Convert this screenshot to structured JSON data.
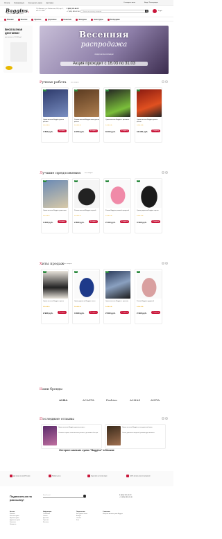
{
  "topbar": {
    "links": [
      "Оплата",
      "Информация",
      "Как сделать заказ",
      "Доставка"
    ],
    "track_label": "Отследить заказ",
    "account_label": "Вход / Регистрация"
  },
  "header": {
    "logo": "Baggins",
    "logo_tagline": "Сумки, рюкзаки и аксессуары",
    "address": "ТЦ «Москва», ул. Люблинская, 169, кор. 2, пав. 2С-136/1",
    "phone": "8 (800) 301-48-22",
    "phone_alt": "+7 (495) 989-47-40",
    "search_placeholder": "Поиск по каталогу товаров",
    "cart_total": "0 руб."
  },
  "nav": {
    "items": [
      "Рюкзаки",
      "Женские",
      "Мужские",
      "Дорожные",
      "Кошельки",
      "Чемоданы",
      "Аксессуары",
      "Распродажа"
    ]
  },
  "promo": {
    "title": "Бесплатная доставка!",
    "subtitle": "при заказе от 10 000 руб."
  },
  "banner": {
    "line1": "Весенняя",
    "line2": "распродажа",
    "line3": "Акция проходит с 16.03 по 31.03",
    "sub": "скидки на все коллекции"
  },
  "sections": {
    "handmade": {
      "title_first": "Р",
      "title_rest": "учная работа",
      "all": "все товары"
    },
    "best": {
      "title_first": "Л",
      "title_rest": "учшие предложения",
      "all": "все товары"
    },
    "hits": {
      "title_first": "Х",
      "title_rest": "иты продаж",
      "all": "все товары"
    },
    "brands": {
      "title_first": "Н",
      "title_rest": "аши бренды"
    },
    "reviews": {
      "title_first": "П",
      "title_rest": "оследние отзывы"
    }
  },
  "cards": [
    {
      "name": "Сумка женская Baggins ручная роспись",
      "stars": "★★★★★",
      "price": "7 890 руб.",
      "cart": "В корзину",
      "badge": "Хит"
    },
    {
      "name": "Рюкзак женский Baggins кожа ручная работа",
      "stars": "★★★★★",
      "price": "9 450 руб.",
      "cart": "В корзину",
      "badge": "Хит"
    },
    {
      "name": "Сумка женская Baggins с росписью",
      "stars": "★★★★★",
      "price": "8 200 руб.",
      "cart": "В корзину",
      "badge": "Хит"
    },
    {
      "name": "Сумка женская Baggins ручная работа",
      "stars": "★★★★★",
      "price": "10 900 руб.",
      "cart": "В корзину",
      "badge": "Хит"
    },
    {
      "name": "Сумка женская Baggins джинсовая",
      "stars": "★★★★★",
      "price": "3 290 руб.",
      "cart": "В корзину",
      "badge": "Хит"
    },
    {
      "name": "Рюкзак женский Baggins черный",
      "stars": "★★★★★",
      "price": "2 890 руб.",
      "cart": "В корзину",
      "badge": "Хит"
    },
    {
      "name": "Рюкзак Baggins розовый городской",
      "stars": "★★★★★",
      "price": "2 490 руб.",
      "cart": "В корзину",
      "badge": "Хит"
    },
    {
      "name": "Сумка дорожная Baggins черная",
      "stars": "★★★★★",
      "price": "3 990 руб.",
      "cart": "В корзину",
      "badge": "Хит"
    },
    {
      "name": "Сумка женская Baggins черная",
      "stars": "★★★★★",
      "price": "2 990 руб.",
      "cart": "В корзину",
      "badge": "Хит"
    },
    {
      "name": "Сумка дорожная Baggins синяя",
      "stars": "★★★★★",
      "price": "3 490 руб.",
      "cart": "В корзину",
      "badge": "Хит"
    },
    {
      "name": "Сумка женская Baggins с принтом",
      "stars": "★★★★★",
      "price": "2 690 руб.",
      "cart": "В корзину",
      "badge": "Хит"
    },
    {
      "name": "Рюкзак Baggins пудровый",
      "stars": "★★★★★",
      "price": "2 990 руб.",
      "cart": "В корзину",
      "badge": "Хит"
    }
  ],
  "brands": [
    "Baggins",
    "ALBA",
    "ACASTA",
    "Fashion",
    "ALMAS",
    "ANIYA"
  ],
  "reviews": [
    {
      "title": "Сумка женская Baggins ручная роспись",
      "text": "Отличная сумка, качественная роспись, доставили быстро."
    },
    {
      "title": "Сумка женская Baggins из натуральной кожи",
      "text": "Очень довольна покупкой, рекомендую магазин."
    }
  ],
  "about": "Интернет-магазин сумок \"Baggins\" в Москве",
  "benefits": [
    "Доставка по всей России",
    "Низкие цены",
    "Гарантия на 12 месяцев",
    "100% оплата после получения"
  ],
  "footer": {
    "subscribe": "Подписаться на рассылку!",
    "email_placeholder": "Ваш E-mail",
    "col1_title": "Каталог",
    "col1": [
      "Рюкзаки",
      "Женские сумки",
      "Мужские сумки",
      "Дорожные сумки",
      "Кошельки",
      "Чемоданы"
    ],
    "col2_title": "Информация",
    "col2": [
      "О магазине",
      "Оплата",
      "Доставка",
      "Гарантия",
      "Контакты"
    ],
    "col3_title": "Покупателям",
    "col3": [
      "Как сделать заказ",
      "Возврат",
      "Отзывы",
      "Блог"
    ],
    "col4_title": "О магазине",
    "col4_text": "Интернет-магазин сумок Baggins"
  },
  "colors": {
    "accent": "#c9163a",
    "dark": "#222222"
  }
}
